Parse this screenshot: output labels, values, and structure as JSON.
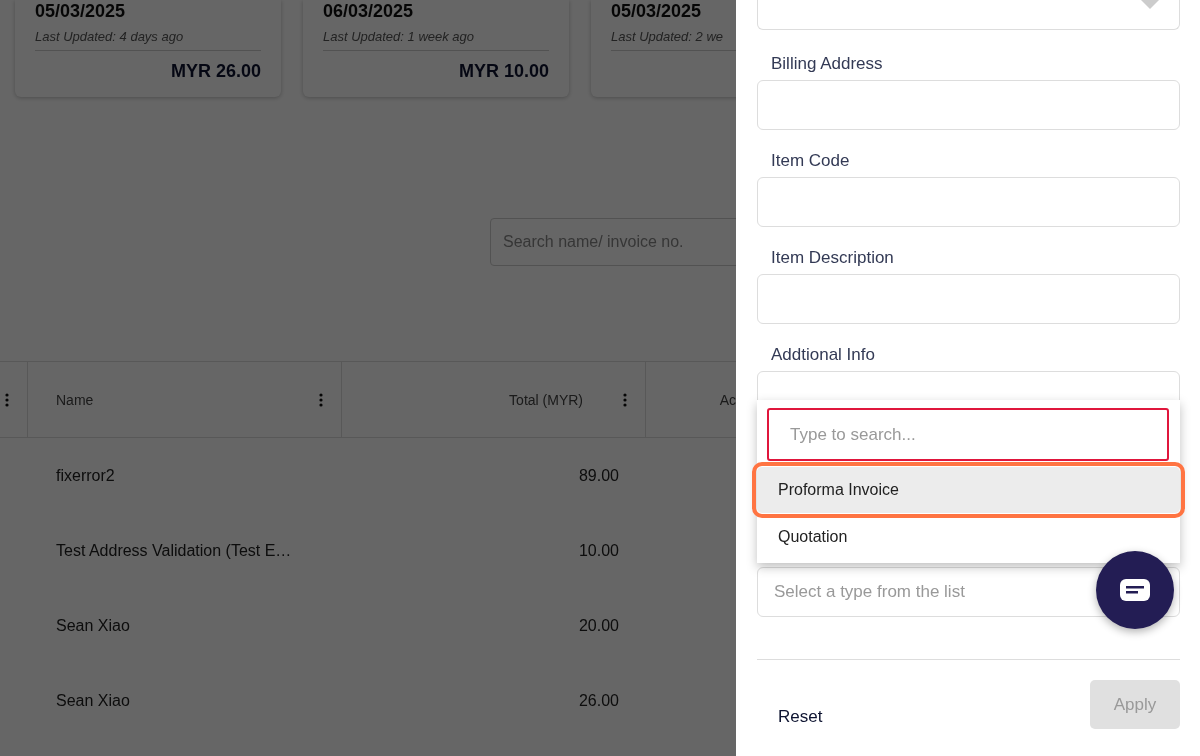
{
  "cards": [
    {
      "date": "05/03/2025",
      "updated": "Last Updated: 4 days ago",
      "amount": "MYR 26.00"
    },
    {
      "date": "06/03/2025",
      "updated": "Last Updated: 1 week ago",
      "amount": "MYR 10.00"
    },
    {
      "date": "05/03/2025",
      "updated": "Last Updated: 2 we"
    }
  ],
  "search": {
    "placeholder": "Search name/ invoice no."
  },
  "table": {
    "columns": [
      {},
      {
        "label": "Name"
      },
      {
        "label": "Total (MYR)"
      },
      {
        "label": "Ac"
      }
    ],
    "rows": [
      {
        "name": "fixerror2",
        "total": "89.00"
      },
      {
        "name": "Test Address Validation (Test E…",
        "total": "10.00"
      },
      {
        "name": "Sean Xiao",
        "total": "20.00"
      },
      {
        "name": "Sean Xiao",
        "total": "26.00"
      }
    ]
  },
  "filter_panel": {
    "fields": [
      {
        "label": "Billing Address"
      },
      {
        "label": "Item Code"
      },
      {
        "label": "Item Description"
      },
      {
        "label": "Addtional Info"
      }
    ],
    "type_select": {
      "placeholder": "Select a type from the list"
    },
    "dropdown": {
      "search_placeholder": "Type to search...",
      "options": [
        {
          "label": "Proforma Invoice",
          "selected": true
        },
        {
          "label": "Quotation",
          "selected": false
        }
      ]
    },
    "buttons": {
      "reset": "Reset",
      "apply": "Apply",
      "apply_disabled": true
    }
  }
}
